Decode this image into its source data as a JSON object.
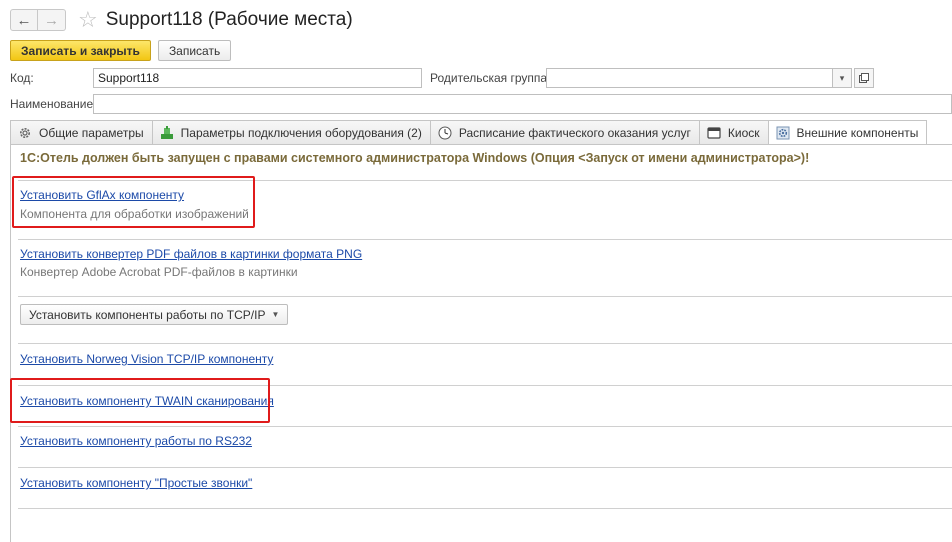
{
  "header": {
    "back_icon": "arrow-left-icon",
    "forward_icon": "arrow-right-icon",
    "title": "Support118 (Рабочие места)"
  },
  "toolbar": {
    "save_close_label": "Записать и закрыть",
    "save_label": "Записать"
  },
  "form": {
    "code_label": "Код:",
    "code_value": "Support118",
    "parent_label": "Родительская группа:",
    "parent_value": "",
    "name_label": "Наименование:",
    "name_value": ""
  },
  "tabs": [
    {
      "label": "Общие параметры",
      "icon": "gear-icon"
    },
    {
      "label": "Параметры подключения оборудования (2)",
      "icon": "equipment-icon"
    },
    {
      "label": "Расписание фактического оказания услуг",
      "icon": "clock-icon"
    },
    {
      "label": "Киоск",
      "icon": "kiosk-icon"
    },
    {
      "label": "Внешние компоненты",
      "icon": "component-gear-icon",
      "active": true
    }
  ],
  "content": {
    "warning": "1С:Отель должен быть запущен с правами системного администратора Windows (Опция <Запуск от имени администратора>)!",
    "gflax_link": "Установить GflAx компоненту",
    "gflax_desc": "Компонента для обработки изображений",
    "pdf_link": "Установить конвертер PDF файлов в картинки формата PNG",
    "pdf_desc": "Конвертер Adobe Acrobat PDF-файлов в картинки",
    "tcp_button": "Установить компоненты работы по TCP/IP",
    "norweg_link": "Установить Norweg Vision TCP/IP компоненту",
    "twain_link": "Установить компоненту TWAIN сканирования",
    "rs232_link": "Установить компоненту работы по RS232",
    "calls_link": "Установить компоненту \"Простые звонки\""
  },
  "colors": {
    "highlight": "#e01b1b",
    "link": "#1c4aa8",
    "primary_button": "#f2c613"
  }
}
